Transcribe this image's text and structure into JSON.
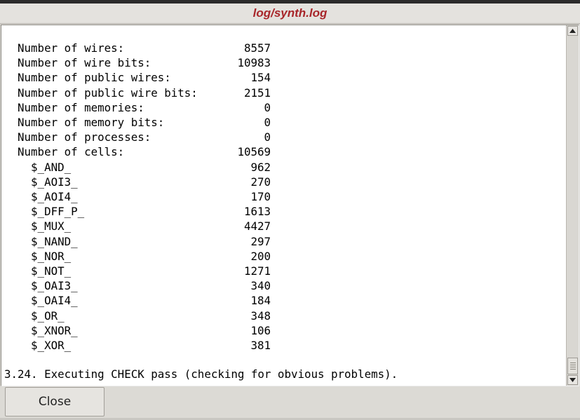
{
  "window": {
    "title": "log/synth.log"
  },
  "stats": [
    {
      "label": "  Number of wires:",
      "value": "8557"
    },
    {
      "label": "  Number of wire bits:",
      "value": "10983"
    },
    {
      "label": "  Number of public wires:",
      "value": "154"
    },
    {
      "label": "  Number of public wire bits:",
      "value": "2151"
    },
    {
      "label": "  Number of memories:",
      "value": "0"
    },
    {
      "label": "  Number of memory bits:",
      "value": "0"
    },
    {
      "label": "  Number of processes:",
      "value": "0"
    },
    {
      "label": "  Number of cells:",
      "value": "10569"
    },
    {
      "label": "    $_AND_",
      "value": "962"
    },
    {
      "label": "    $_AOI3_",
      "value": "270"
    },
    {
      "label": "    $_AOI4_",
      "value": "170"
    },
    {
      "label": "    $_DFF_P_",
      "value": "1613"
    },
    {
      "label": "    $_MUX_",
      "value": "4427"
    },
    {
      "label": "    $_NAND_",
      "value": "297"
    },
    {
      "label": "    $_NOR_",
      "value": "200"
    },
    {
      "label": "    $_NOT_",
      "value": "1271"
    },
    {
      "label": "    $_OAI3_",
      "value": "340"
    },
    {
      "label": "    $_OAI4_",
      "value": "184"
    },
    {
      "label": "    $_OR_",
      "value": "348"
    },
    {
      "label": "    $_XNOR_",
      "value": "106"
    },
    {
      "label": "    $_XOR_",
      "value": "381"
    }
  ],
  "section_line": "3.24. Executing CHECK pass (checking for obvious problems).",
  "buttons": {
    "close": "Close"
  },
  "colors": {
    "title": "#a8262a"
  }
}
